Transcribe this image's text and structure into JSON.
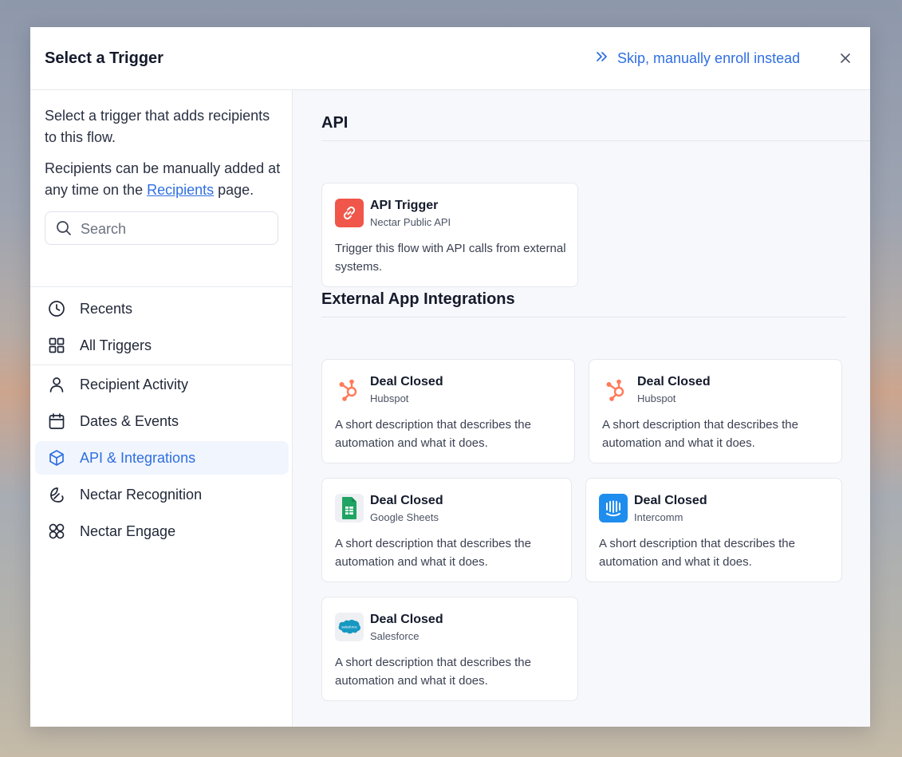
{
  "modal": {
    "title": "Select a Trigger",
    "skip_label": "Skip, manually enroll instead"
  },
  "sidebar": {
    "intro_line1": "Select a trigger that adds recipients to this flow.",
    "intro_line2_before": "Recipients can be manually added at any time on the ",
    "intro_link": "Recipients",
    "intro_line2_after": " page.",
    "search_placeholder": "Search",
    "items": [
      {
        "label": "Recents",
        "icon": "clock-icon"
      },
      {
        "label": "All Triggers",
        "icon": "grid-icon"
      },
      {
        "label": "Recipient Activity",
        "icon": "user-icon"
      },
      {
        "label": "Dates & Events",
        "icon": "calendar-icon"
      },
      {
        "label": "API & Integrations",
        "icon": "cube-icon",
        "active": true
      },
      {
        "label": "Nectar Recognition",
        "icon": "recognition-icon"
      },
      {
        "label": "Nectar Engage",
        "icon": "engage-icon"
      }
    ]
  },
  "sections": {
    "api": {
      "title": "API",
      "cards": [
        {
          "title": "API Trigger",
          "subtitle": "Nectar Public API",
          "description": "Trigger this flow with API calls from external systems.",
          "icon": "link-icon"
        }
      ]
    },
    "integrations": {
      "title": "External App Integrations",
      "cards": [
        {
          "title": "Deal Closed",
          "subtitle": "Hubspot",
          "description": "A short description that describes the automation and what it does.",
          "icon": "hubspot-icon"
        },
        {
          "title": "Deal Closed",
          "subtitle": "Hubspot",
          "description": "A short description that describes the automation and what it does.",
          "icon": "hubspot-icon"
        },
        {
          "title": "Deal Closed",
          "subtitle": "Google Sheets",
          "description": "A short description that describes the automation and what it does.",
          "icon": "google-sheets-icon"
        },
        {
          "title": "Deal Closed",
          "subtitle": "Intercomm",
          "description": "A short description that describes the automation and what it does.",
          "icon": "intercom-icon"
        },
        {
          "title": "Deal Closed",
          "subtitle": "Salesforce",
          "description": "A short description that describes the automation and what it does.",
          "icon": "salesforce-icon",
          "logo_text": "salesforce"
        }
      ]
    }
  },
  "colors": {
    "accent": "#2f6fe0",
    "active_bg": "#f1f5fd",
    "hubspot": "#ff7a59",
    "api_red": "#f0564a",
    "sheets_green": "#1fa463",
    "intercom_blue": "#1f8ded",
    "salesforce_blue": "#1798c1"
  }
}
